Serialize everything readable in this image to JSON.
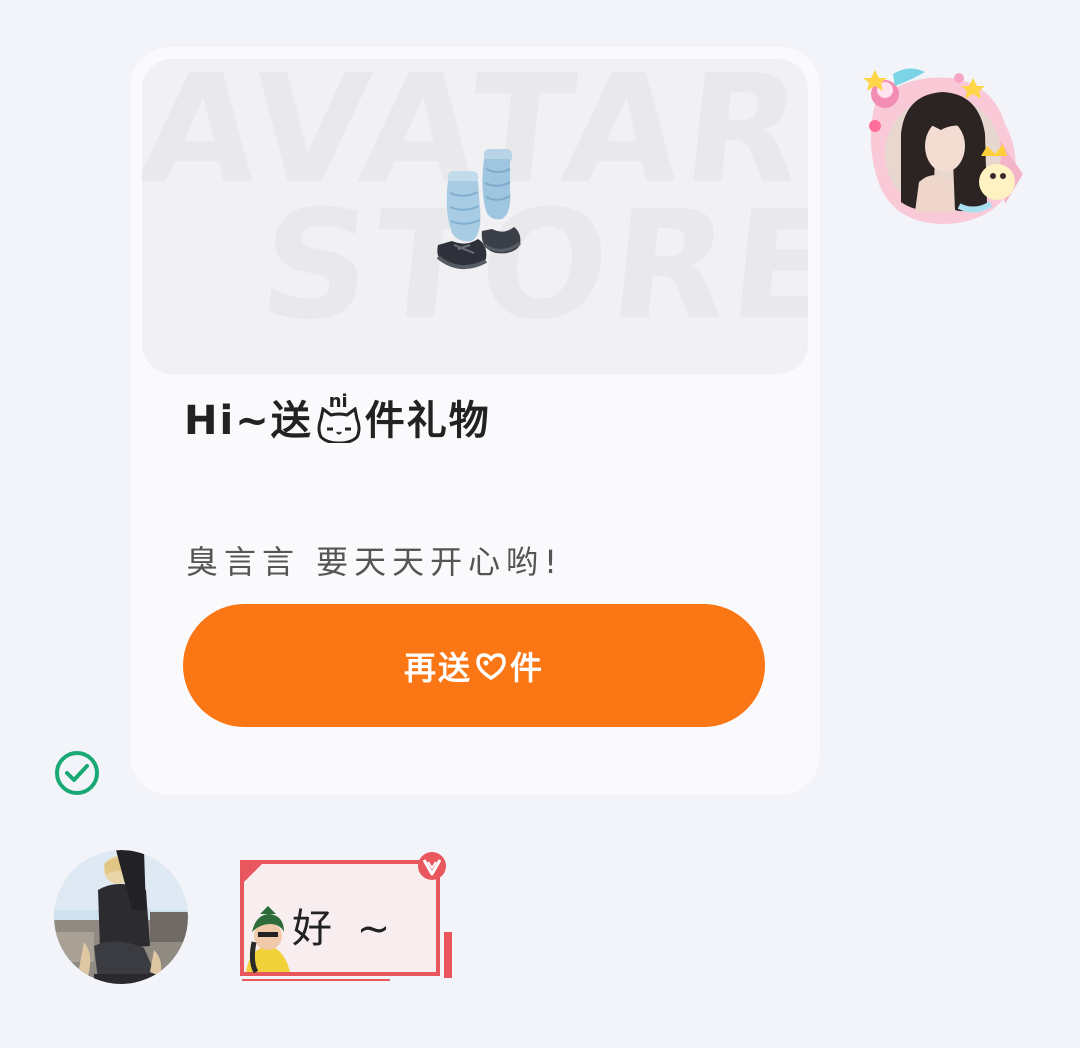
{
  "gift_card": {
    "banner_watermark_line1": "AVATAR",
    "banner_watermark_line2": "STORE",
    "title_prefix": "Hi~送",
    "title_icon_label": "ni",
    "title_suffix": "件礼物",
    "subtitle": "臭言言 要天天开心哟!",
    "button_prefix": "再送",
    "button_suffix": "件",
    "gift_icon": "blue-leg-warmer-boots-icon",
    "title_icon": "cat-face-icon",
    "button_icon": "heart-pendant-icon"
  },
  "reply": {
    "text": "好 ~",
    "sticker_icon": "girl-sticker-icon",
    "badge_icon": "v-badge-icon"
  },
  "status": {
    "sent_icon": "check-circle-icon",
    "sent_color": "#19a974"
  },
  "colors": {
    "accent": "#fb7614",
    "bubble_border": "#e8575e",
    "page_bg": "#f3f4f9",
    "card_bg": "#fafafd"
  },
  "avatars": {
    "sender_frame_icon": "sweets-avatar-frame-icon",
    "receiver_icon": "user-avatar-icon"
  }
}
